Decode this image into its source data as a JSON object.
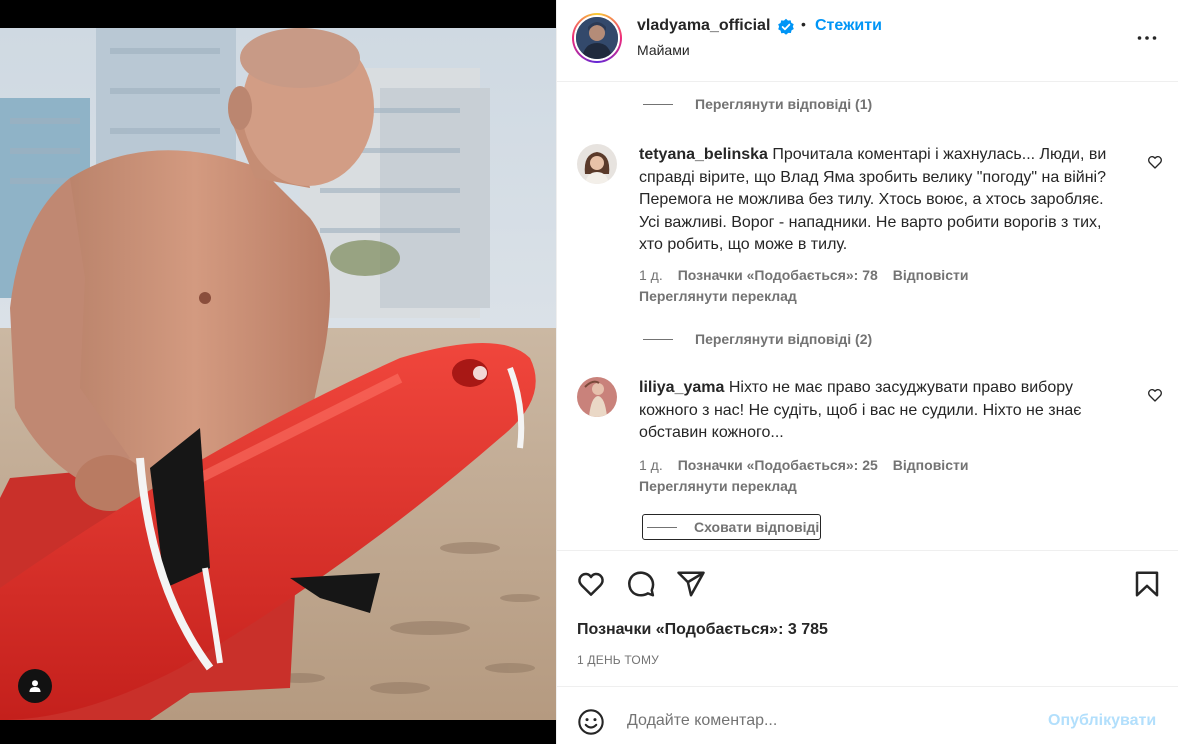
{
  "post": {
    "author": {
      "username": "vladyama_official",
      "verified": true,
      "separator": "•",
      "follow_label": "Стежити",
      "location": "Майами"
    },
    "more_options_icon": "more-horizontal-icon",
    "tag_icon": "user-tag-icon"
  },
  "comments_section": {
    "view_replies_top": "Переглянути відповіді (1)",
    "comments": [
      {
        "username": "tetyana_belinska",
        "text": "Прочитала коментарі і жахнулась... Люди, ви справді вірите, що Влад Яма зробить велику \"погоду\" на війні? Перемога не можлива без тилу. Хтось воює, а хтось заробляє. Усі важливі. Ворог - нападники. Не варто робити ворогів з тих, хто робить, що може в тилу.",
        "time": "1 д.",
        "likes": "Позначки «Подобається»: 78",
        "reply_label": "Відповісти",
        "translate_label": "Переглянути переклад",
        "view_replies": "Переглянути відповіді (2)"
      },
      {
        "username": "liliya_yama",
        "text": "Ніхто не має право засуджувати право вибору кожного з нас! Не судіть, щоб і вас не судили. Ніхто не знає обставин кожного...",
        "time": "1 д.",
        "likes": "Позначки «Подобається»: 25",
        "reply_label": "Відповісти",
        "translate_label": "Переглянути переклад"
      }
    ],
    "hide_replies_label": "Сховати відповіді"
  },
  "actions": {
    "icons": [
      "heart-icon",
      "comment-icon",
      "share-icon",
      "bookmark-icon"
    ],
    "likes_count": "Позначки «Подобається»: 3 785",
    "time_ago": "1 ДЕНЬ ТОМУ"
  },
  "composer": {
    "placeholder": "Додайте коментар...",
    "publish_label": "Опублікувати",
    "emoji_icon": "emoji-icon"
  },
  "colors": {
    "accent": "#0095f6",
    "accent_disabled": "#b2dffc",
    "text": "#262626",
    "secondary_text": "#737373",
    "divider": "#efefef"
  }
}
